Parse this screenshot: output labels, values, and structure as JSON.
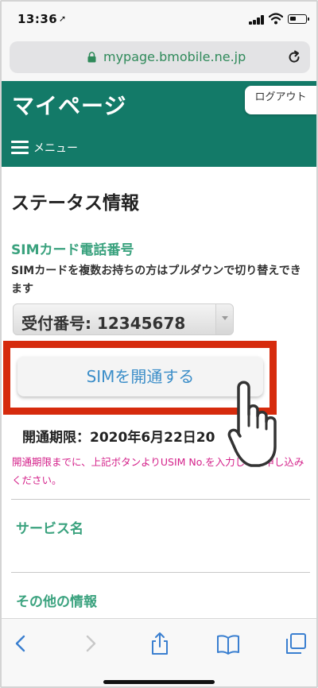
{
  "status_bar": {
    "time": "13:36",
    "location_glyph": "➚"
  },
  "browser": {
    "url": "mypage.bmobile.ne.jp"
  },
  "header": {
    "title": "マイページ",
    "logout_label": "ログアウト",
    "menu_label": "メニュー",
    "brand_color": "#137a68"
  },
  "status": {
    "section_title": "ステータス情報",
    "sim_heading": "SIMカード電話番号",
    "note": "SIMカードを複数お持ちの方はプルダウンで切り替えできます",
    "selected_number": "受付番号: 12345678",
    "activate_button": "SIMを開通する",
    "deadline": "開通期限：2020年6月22日20",
    "deadline_note": "開通期限までに、上記ボタンよりUSIM No.を入力してお申し込みください。"
  },
  "sections": {
    "service_name": "サービス名",
    "other_info": "その他の情報"
  },
  "icons": {
    "lock": "lock-icon",
    "reload": "reload-icon",
    "menu": "hamburger-icon",
    "pointer": "pointing-hand-icon",
    "back": "chevron-left-icon",
    "forward": "chevron-right-icon",
    "share": "share-icon",
    "bookmarks": "book-icon",
    "tabs": "tabs-icon"
  },
  "colors": {
    "accent_green": "#3aa27e",
    "highlight_red": "#d62b0d",
    "link_blue": "#3a8dc8",
    "warning_pink": "#d4218a"
  }
}
